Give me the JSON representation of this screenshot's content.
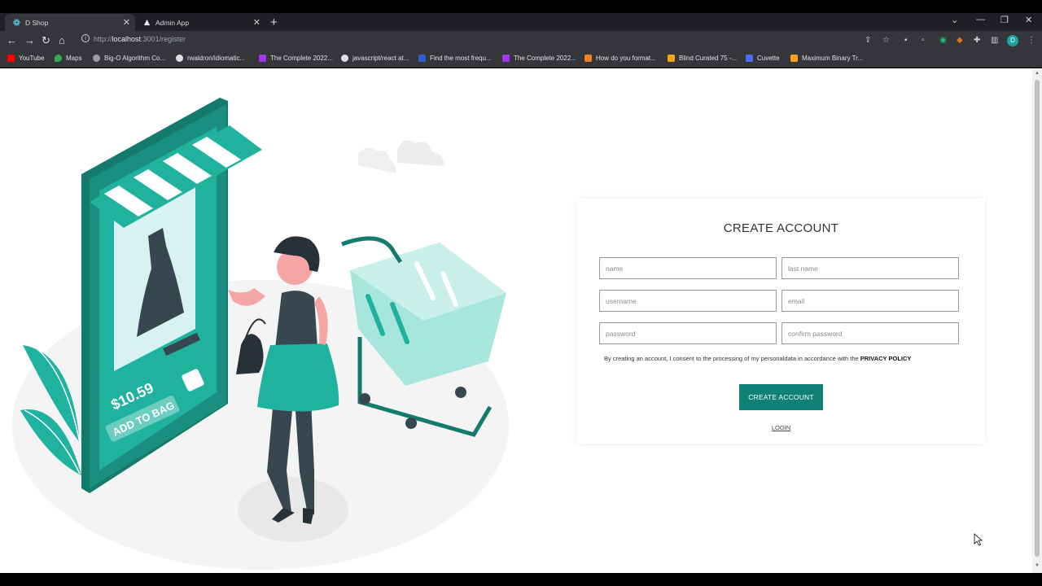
{
  "browser": {
    "tabs": [
      {
        "title": "D Shop",
        "active": true
      },
      {
        "title": "Admin App",
        "active": false
      }
    ],
    "url_prefix": "http://",
    "url_host": "localhost",
    "url_path": ":3001/register",
    "profile_initial": "D",
    "bookmarks": [
      {
        "label": "YouTube",
        "color": "#ff0000"
      },
      {
        "label": "Maps",
        "color": "#34a853"
      },
      {
        "label": "Big-O Algorithm Co...",
        "color": "#9e9e9e"
      },
      {
        "label": "rwaldron/idiomatic...",
        "color": "#e0e0e0"
      },
      {
        "label": "The Complete 2022...",
        "color": "#a435f0"
      },
      {
        "label": "javascript/react at...",
        "color": "#e0e0e0"
      },
      {
        "label": "Find the most frequ...",
        "color": "#2f5bd3"
      },
      {
        "label": "The Complete 2022...",
        "color": "#a435f0"
      },
      {
        "label": "How do you format...",
        "color": "#f48024"
      },
      {
        "label": "Blind Curated 75 -...",
        "color": "#ffa116"
      },
      {
        "label": "Cuvette",
        "color": "#4a6cf7"
      },
      {
        "label": "Maximum Binary Tr...",
        "color": "#ffa116"
      }
    ]
  },
  "illustration": {
    "price": "$10.59",
    "cta": "ADD TO BAG"
  },
  "form": {
    "title": "CREATE ACCOUNT",
    "fields": {
      "name": "name",
      "last_name": "last name",
      "username": "username",
      "email": "email",
      "password": "password",
      "confirm_password": "confirm password"
    },
    "consent_text": "By creating an account, I consent to the processing of my personaldata in accordance with the ",
    "consent_link": "PRIVACY POLICY",
    "submit_label": "CREATE ACCOUNT",
    "login_label": "LOGIN"
  },
  "colors": {
    "accent": "#0f8178",
    "illustration_teal": "#1fb39f",
    "dark_teal": "#137a6c"
  }
}
